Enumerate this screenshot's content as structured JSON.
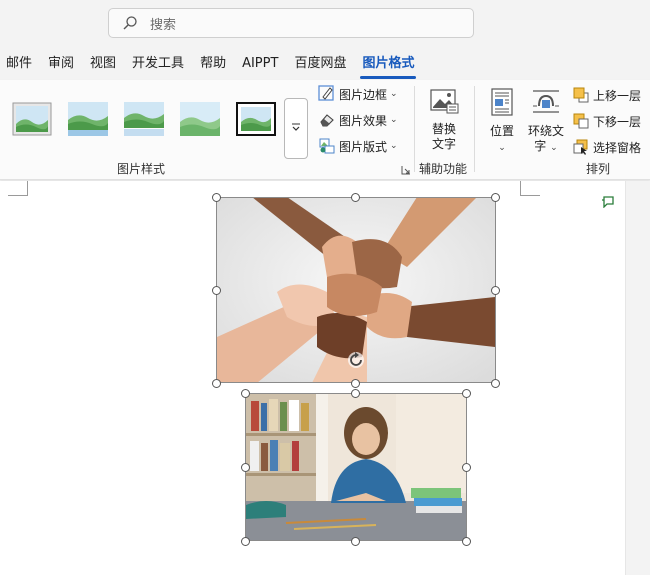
{
  "search": {
    "placeholder": "搜索"
  },
  "tabs": [
    {
      "label": "邮件",
      "active": false
    },
    {
      "label": "审阅",
      "active": false
    },
    {
      "label": "视图",
      "active": false
    },
    {
      "label": "开发工具",
      "active": false
    },
    {
      "label": "帮助",
      "active": false
    },
    {
      "label": "AIPPT",
      "active": false
    },
    {
      "label": "百度网盘",
      "active": false
    },
    {
      "label": "图片格式",
      "active": true
    }
  ],
  "ribbon": {
    "picture_styles": {
      "label": "图片样式",
      "border_label": "图片边框",
      "effects_label": "图片效果",
      "layout_label": "图片版式"
    },
    "accessibility": {
      "label": "辅助功能",
      "alt_text_line1": "替换",
      "alt_text_line2": "文字"
    },
    "arrange": {
      "label": "排列",
      "position_label": "位置",
      "wrap_line1": "环绕文",
      "wrap_line2": "字",
      "bring_forward": "上移一层",
      "send_backward": "下移一层",
      "selection_pane": "选择窗格"
    }
  },
  "colors": {
    "accent": "#185abd",
    "ribbon_bg": "#fbfbfb",
    "doc_bg": "#ffffff",
    "comment_green": "#2a7d3a"
  }
}
